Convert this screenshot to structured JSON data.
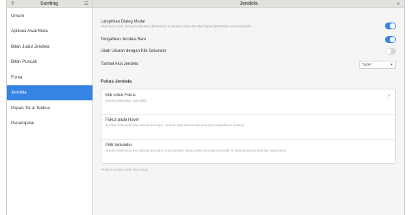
{
  "window": {
    "sidebar_header_title": "Sunting",
    "title": "Jendela",
    "search_icon": "search-icon",
    "menu_icon": "menu-icon",
    "close_icon": "close-icon"
  },
  "sidebar": {
    "items": [
      {
        "label": "Umum",
        "active": false
      },
      {
        "label": "Aplikasi Awal Mula",
        "active": false
      },
      {
        "label": "Bilah Judul Jendela",
        "active": false
      },
      {
        "label": "Bilah Puncak",
        "active": false
      },
      {
        "label": "Fonta",
        "active": false
      },
      {
        "label": "Jendela",
        "active": true
      },
      {
        "label": "Papan Tik & Tetikus",
        "active": false
      },
      {
        "label": "Penampilan",
        "active": false
      }
    ]
  },
  "settings": {
    "row1": {
      "label": "Lampirkan Dialog Modal",
      "desc": "Saat fitur ini aktif, dialog modal akan dilampirkan ke jendela induk dan tidak dapat dipindahkan secara terpisah.",
      "on": true
    },
    "row2": {
      "label": "Tengahkan Jendela Baru",
      "on": true
    },
    "row3": {
      "label": "Ubah Ukuran dengan Klik Sekunder",
      "on": false
    },
    "row4": {
      "label": "Tombol Aksi Jendela",
      "value": "Super"
    }
  },
  "section": {
    "title": "Fokus Jendela",
    "items": [
      {
        "title": "Klik untuk Fokus",
        "sub": "Jendela difokuskan saat diklik.",
        "selected": true
      },
      {
        "title": "Fokus pada Hover",
        "sub": "Jendela difokuskan saat dilewati penunjuk. Jendela tetap fokus ketika penunjuk berpindah ke desktop."
      },
      {
        "title": "Pilih Sekunder",
        "sub": "Jendela difokuskan saat dilewati penunjuk. Fokus jendela hilang ketika penunjuk berpindah ke desktop atau jendela lain tanpa fokus."
      }
    ],
    "footnote": "Pastikan jendela untuk fokus tetap."
  }
}
